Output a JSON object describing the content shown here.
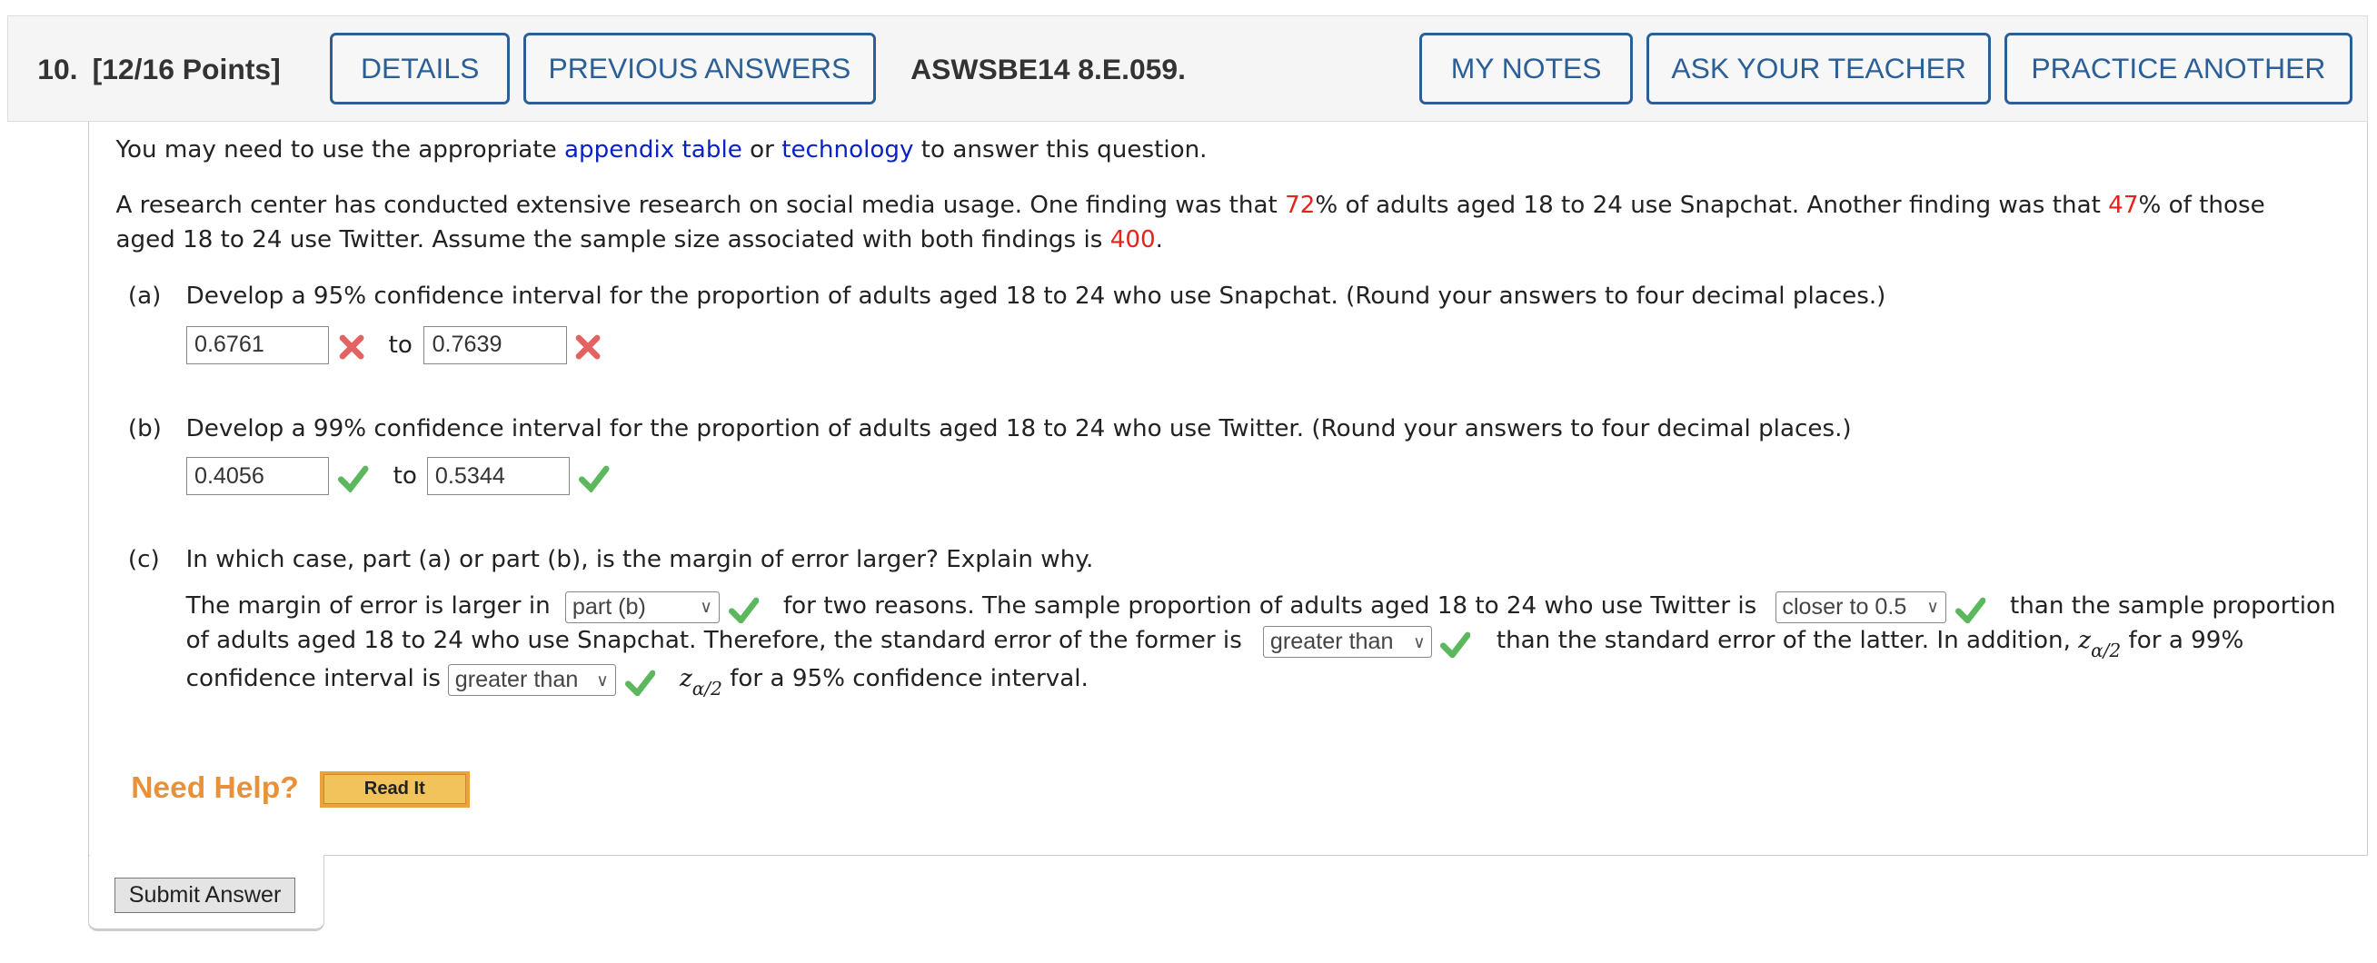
{
  "header": {
    "question_number": "10.",
    "points": "[12/16 Points]",
    "details_label": "DETAILS",
    "previous_answers_label": "PREVIOUS ANSWERS",
    "problem_id": "ASWSBE14 8.E.059.",
    "my_notes_label": "MY NOTES",
    "ask_teacher_label": "ASK YOUR TEACHER",
    "practice_another_label": "PRACTICE ANOTHER"
  },
  "intro": {
    "pre": "You may need to use the appropriate ",
    "link1": "appendix table",
    "mid": " or ",
    "link2": "technology",
    "post": " to answer this question."
  },
  "problem": {
    "l1a": "A research center has conducted extensive research on social media usage. One finding was that ",
    "pct1": "72",
    "l1b": "% of adults aged 18 to 24 use Snapchat. Another finding was that ",
    "pct2": "47",
    "l1c": "% of those",
    "l2a": "aged 18 to 24 use Twitter. Assume the sample size associated with both findings is ",
    "n": "400",
    "l2b": "."
  },
  "part_a": {
    "label": "(a)",
    "question": "Develop a 95% confidence interval for the proportion of adults aged 18 to 24 who use Snapchat. (Round your answers to four decimal places.)",
    "lower": "0.6761",
    "upper": "0.7639",
    "to": "to",
    "status": "incorrect"
  },
  "part_b": {
    "label": "(b)",
    "question": "Develop a 99% confidence interval for the proportion of adults aged 18 to 24 who use Twitter. (Round your answers to four decimal places.)",
    "lower": "0.4056",
    "upper": "0.5344",
    "to": "to",
    "status": "correct"
  },
  "part_c": {
    "label": "(c)",
    "question": "In which case, part (a) or part (b), is the margin of error larger? Explain why.",
    "s1": "The margin of error is larger in",
    "sel1": "part (b)",
    "s2": "for two reasons. The sample proportion of adults aged 18 to 24 who use Twitter is",
    "sel2": "closer to 0.5",
    "s3": "than the sample proportion",
    "s4": "of adults aged 18 to 24 who use Snapchat. Therefore, the standard error of the former is",
    "sel3": "greater than",
    "s5": "than the standard error of the latter. In addition,",
    "z": "z",
    "zsub": "α/2",
    "s6": "for a 99%",
    "s7": "confidence interval is",
    "sel4": "greater than",
    "s8": "for a 95% confidence interval."
  },
  "help": {
    "need_help": "Need Help?",
    "read_it": "Read It"
  },
  "submit_label": "Submit Answer",
  "colors": {
    "accent": "#2b5f95",
    "highlight": "#e3241d",
    "correct": "#5cb85c",
    "incorrect": "#e05a5a",
    "help": "#e8913a"
  }
}
